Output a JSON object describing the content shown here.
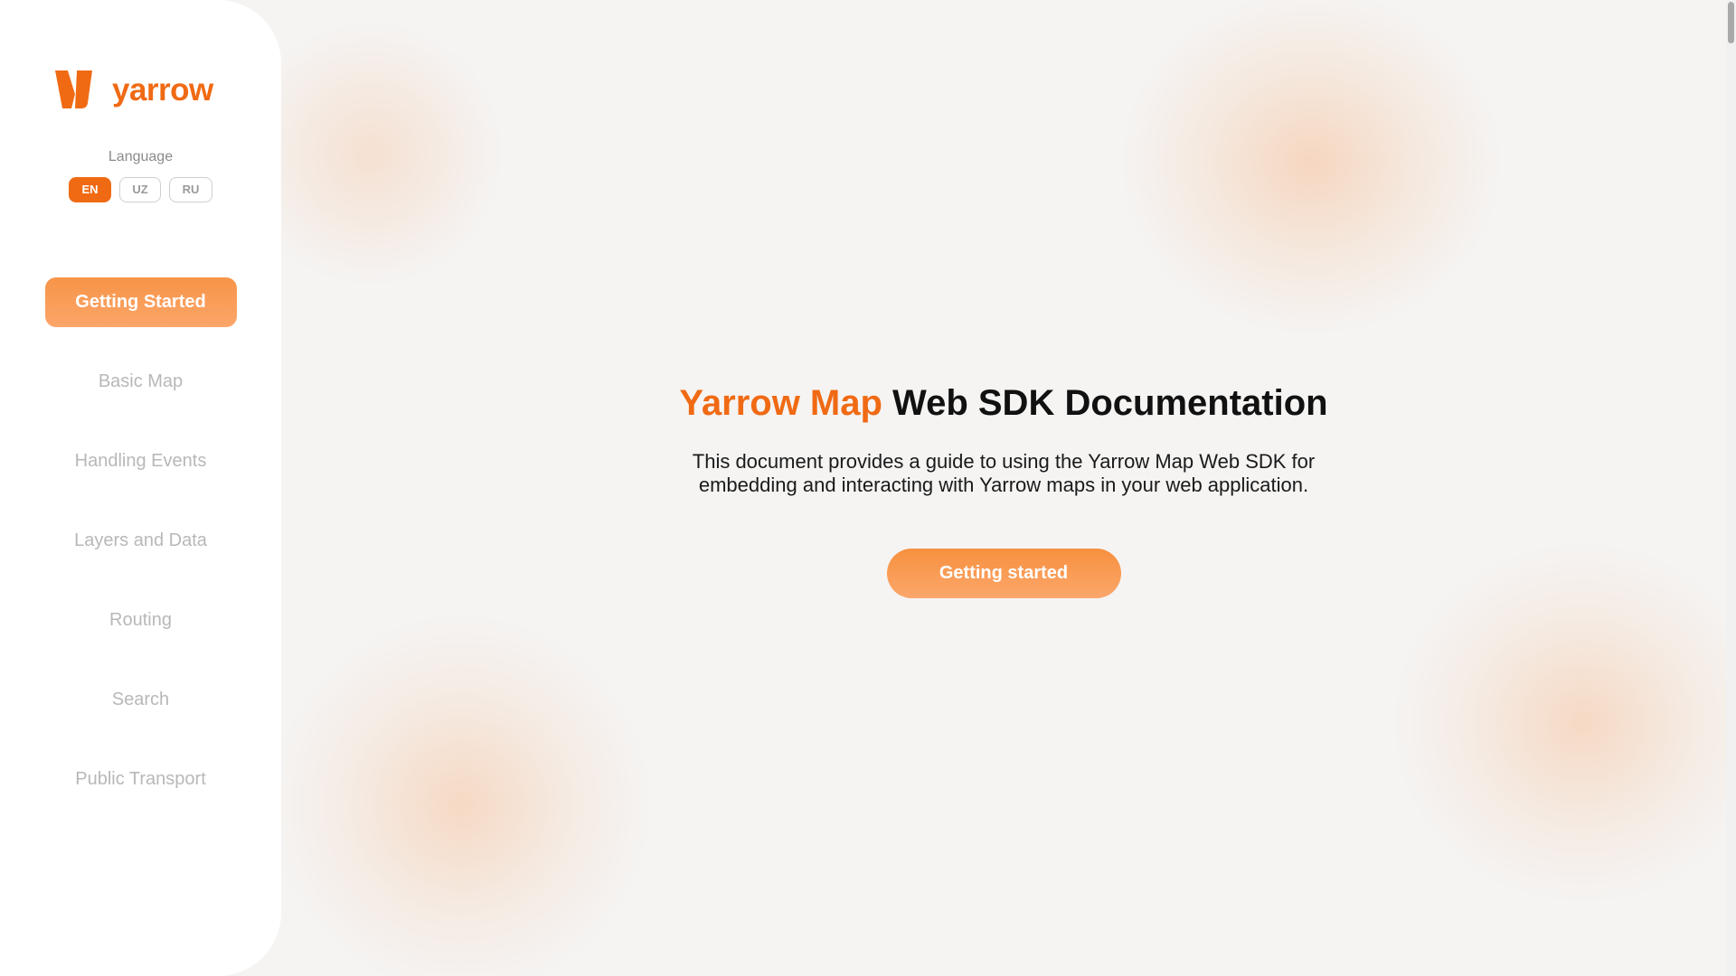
{
  "brand": {
    "name": "yarrow",
    "color": "#f06a14"
  },
  "language": {
    "label": "Language",
    "options": [
      "EN",
      "UZ",
      "RU"
    ],
    "selected": "EN"
  },
  "sidebar": {
    "items": [
      {
        "label": "Getting Started",
        "active": true
      },
      {
        "label": "Basic Map",
        "active": false
      },
      {
        "label": "Handling Events",
        "active": false
      },
      {
        "label": "Layers and Data",
        "active": false
      },
      {
        "label": "Routing",
        "active": false
      },
      {
        "label": "Search",
        "active": false
      },
      {
        "label": "Public Transport",
        "active": false
      }
    ]
  },
  "hero": {
    "title_accent": "Yarrow Map",
    "title_rest": " Web SDK Documentation",
    "description": "This document provides a guide to using the Yarrow Map Web SDK for embedding and interacting with Yarrow maps in your web application.",
    "cta_label": "Getting started"
  },
  "icons": {
    "logo": "yarrow-logo-icon"
  }
}
